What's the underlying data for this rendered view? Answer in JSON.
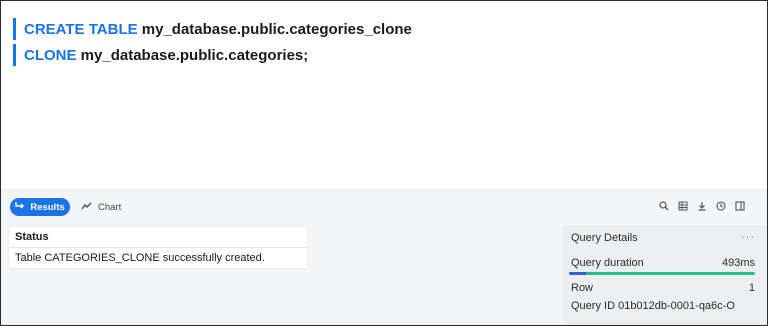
{
  "editor": {
    "line1": {
      "keyword": "CREATE TABLE",
      "rest": " my_database.public.categories_clone"
    },
    "line2": {
      "keyword": "CLONE",
      "rest": " my_database.public.categories;"
    }
  },
  "toolbar": {
    "results_label": "Results",
    "chart_label": "Chart",
    "icons": [
      "search-icon",
      "columns-icon",
      "download-icon",
      "history-icon",
      "split-view-icon"
    ]
  },
  "results": {
    "columns": [
      "Status"
    ],
    "rows": [
      [
        "Table CATEGORIES_CLONE successfully created."
      ]
    ]
  },
  "query_details": {
    "title": "Query Details",
    "duration_label": "Query duration",
    "duration_value": "493ms",
    "row_label": "Row",
    "row_value": "1",
    "query_id_label": "Query ID",
    "query_id_value": "01b012db-0001-qa6c-O",
    "duration_bar": {
      "compile_fraction": 0.09,
      "execute_fraction": 0.91
    }
  },
  "colors": {
    "accent": "#1a73e8",
    "keyword": "#1a73e8",
    "bar_compile": "#3b5bdb",
    "bar_execute": "#22c08a"
  }
}
